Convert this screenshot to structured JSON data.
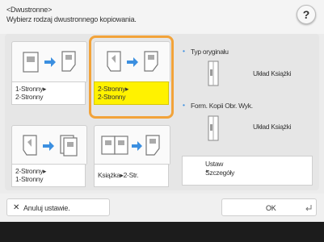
{
  "header": {
    "line1": "<Dwustronne>",
    "line2": "Wybierz rodzaj dwustronnego kopiowania.",
    "help_label": "?"
  },
  "options": [
    {
      "label": "1-Stronny▸\n2-Stronny",
      "selected": false
    },
    {
      "label": "2-Stronny▸\n2-Stronny",
      "selected": true
    },
    {
      "label": "2-Stronny▸\n1-Stronny",
      "selected": false
    },
    {
      "label": "Książka▸2-Str.",
      "selected": false
    }
  ],
  "right_panel": {
    "original_type": {
      "label": "Typ oryginału",
      "value": "Układ Książki"
    },
    "copy_format": {
      "label": "Form. Kopii Obr. Wyk.",
      "value": "Układ Książki"
    },
    "settings_button": "Ustaw\nSzczegóły"
  },
  "footer": {
    "cancel_label": "Anuluj ustawie.",
    "ok_label": "OK"
  },
  "colors": {
    "selection_frame": "#f2a33a",
    "selected_label": "#fff200",
    "bullet": "#3b8fe0",
    "arrow": "#3b8fe0"
  }
}
